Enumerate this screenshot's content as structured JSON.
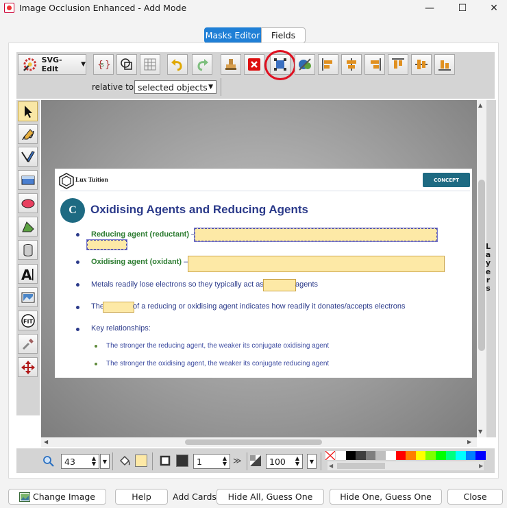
{
  "window": {
    "title": "Image Occlusion Enhanced - Add Mode",
    "minimize": "—",
    "maximize": "☐",
    "close": "✕"
  },
  "tabs": [
    {
      "label": "Masks Editor",
      "active": true
    },
    {
      "label": "Fields",
      "active": false
    }
  ],
  "toolbar": {
    "svgedit_label": "SVG-Edit",
    "relative_label": "relative to:",
    "relative_value": "selected objects"
  },
  "slide": {
    "logo_text": "Lux Tuition",
    "badge": "CONCEPT",
    "circle_letter": "C",
    "title": "Oxidising Agents and Reducing Agents",
    "line1_label": "Reducing agent (reductant)",
    "line1_dash": " —",
    "line2_label": "Oxidising agent (oxidant)",
    "line2_dash": " —",
    "line3_a": "Metals readily lose electrons so they typically act as",
    "line3_b": " agents",
    "line4_a": "The",
    "line4_b": " of a reducing or oxidising agent indicates how readily it donates/accepts electrons",
    "line5": "Key relationships:",
    "sub1": "The stronger the reducing agent, the weaker its conjugate oxidising agent",
    "sub2": "The stronger the oxidising agent, the weaker its conjugate reducing agent"
  },
  "layers_label": "Layers",
  "bottom_toolbar": {
    "zoom": "43",
    "stroke_width": "1",
    "opacity": "100",
    "fill_color": "#fde9a6",
    "stroke_color": "#333333"
  },
  "palette": [
    "#ffffff",
    "#000000",
    "#3f3f3f",
    "#7f7f7f",
    "#bfbfbf",
    "#ffffff",
    "#ff0000",
    "#ff7f00",
    "#ffff00",
    "#7fff00",
    "#00ff00",
    "#00ff7f",
    "#00ffff",
    "#007fff",
    "#0000ff"
  ],
  "footer": {
    "change_image": "Change Image",
    "help": "Help",
    "add_cards": "Add Cards:",
    "hide_all": "Hide All, Guess One",
    "hide_one": "Hide One, Guess One",
    "close": "Close"
  }
}
